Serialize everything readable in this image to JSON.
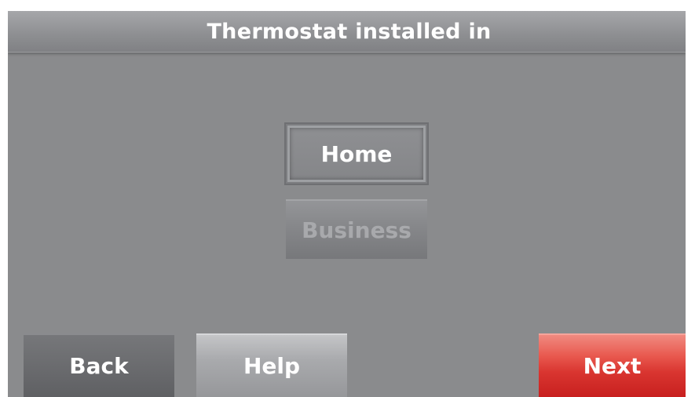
{
  "header": {
    "title": "Thermostat installed in"
  },
  "options": {
    "home_label": "Home",
    "business_label": "Business",
    "selected": "Home"
  },
  "footer": {
    "back_label": "Back",
    "help_label": "Help",
    "next_label": "Next"
  },
  "colors": {
    "background": "#8a8b8d",
    "next_button": "#d93530",
    "text": "#ffffff"
  }
}
